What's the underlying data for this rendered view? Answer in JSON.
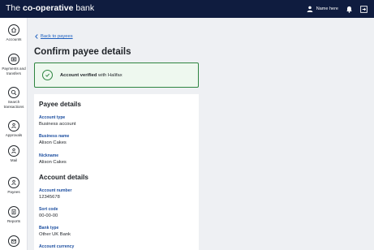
{
  "header": {
    "brand_pre": "The",
    "brand_name": "co-operative",
    "brand_post": "bank",
    "user_name": "Name here",
    "icons": [
      "person-icon",
      "bell-icon",
      "logout-icon"
    ]
  },
  "sidebar": {
    "items": [
      {
        "label": "Accounts",
        "icon": "home-icon"
      },
      {
        "label": "Payments and transfers",
        "icon": "payments-icon"
      },
      {
        "label": "Search transactions",
        "icon": "search-icon"
      },
      {
        "label": "Approvals",
        "icon": "approvals-icon"
      },
      {
        "label": "Mail",
        "icon": "mail-icon"
      },
      {
        "label": "Payees",
        "icon": "payees-icon"
      },
      {
        "label": "Reports",
        "icon": "reports-icon"
      },
      {
        "label": "",
        "icon": "document-icon"
      }
    ]
  },
  "main": {
    "back_link": "Back to payees",
    "title": "Confirm payee details",
    "verified": {
      "strong": "Account verified",
      "rest": " with Halifax"
    },
    "payee_section": "Payee details",
    "account_section": "Account details",
    "fields": {
      "account_type_label": "Account type",
      "account_type_value": "Business account",
      "business_name_label": "Business name",
      "business_name_value": "Alison Cakes",
      "nickname_label": "Nickname",
      "nickname_value": "Alison Cakes",
      "account_number_label": "Account number",
      "account_number_value": "12345678",
      "sort_code_label": "Sort code",
      "sort_code_value": "00-00-00",
      "bank_type_label": "Bank type",
      "bank_type_value": "Other UK Bank",
      "account_currency_label": "Account currency"
    }
  },
  "colors": {
    "header_bg": "#0f1c3f",
    "link": "#1d5fbf",
    "success": "#2e8540",
    "field_label": "#1d4fa0"
  }
}
